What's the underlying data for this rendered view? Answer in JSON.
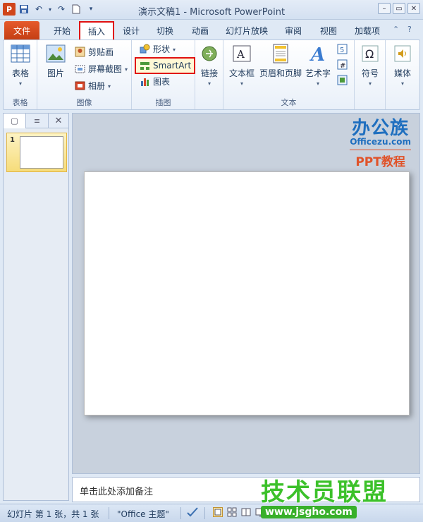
{
  "titlebar": {
    "title": "演示文稿1  -  Microsoft PowerPoint",
    "app_icon": "P",
    "qat": [
      "save-icon",
      "undo-icon",
      "redo-icon",
      "new-icon",
      "customize-icon"
    ]
  },
  "tabs": {
    "file": "文件",
    "items": [
      "开始",
      "插入",
      "设计",
      "切换",
      "动画",
      "幻灯片放映",
      "审阅",
      "视图",
      "加载项"
    ],
    "active": "插入"
  },
  "ribbon": {
    "groups": {
      "table": {
        "label": "表格",
        "btn": "表格"
      },
      "images": {
        "label": "图像",
        "picture": "图片",
        "clipart": "剪贴画",
        "screenshot": "屏幕截图",
        "album": "相册"
      },
      "illustrations": {
        "label": "插图",
        "shapes": "形状",
        "smartart": "SmartArt",
        "chart": "图表"
      },
      "links": {
        "btn": "链接"
      },
      "text": {
        "label": "文本",
        "textbox": "文本框",
        "header_footer": "页眉和页脚",
        "wordart": "艺术字"
      },
      "symbols": {
        "btn": "符号"
      },
      "media": {
        "btn": "媒体"
      }
    }
  },
  "slides_pane": {
    "thumb_number": "1"
  },
  "brand": {
    "line1": "办公族",
    "line2": "Officezu.com",
    "line3": "PPT教程"
  },
  "notes": {
    "placeholder": "单击此处添加备注"
  },
  "statusbar": {
    "slide_info": "幻灯片 第 1 张，共 1 张",
    "theme": "\"Office 主题\""
  },
  "watermark": {
    "line1": "技术员联盟",
    "line2": "www.jsgho.com"
  }
}
